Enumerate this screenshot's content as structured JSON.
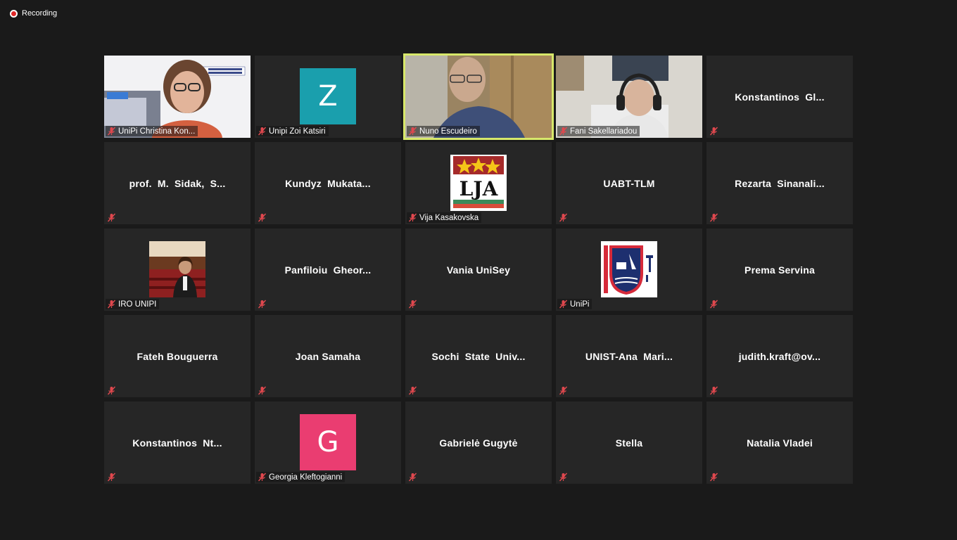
{
  "recording": {
    "label": "Recording"
  },
  "colors": {
    "background": "#1a1a1a",
    "tile": "#262626",
    "active_speaker": "#d7e86a",
    "mute": "#e0484e",
    "teal_avatar": "#1a9fad",
    "pink_avatar": "#ea3d71"
  },
  "tiles": [
    {
      "display": "video",
      "label": "UniPi Christina Kon..."
    },
    {
      "display": "letter",
      "letter": "Z",
      "label": "Unipi Zoi Katsiri"
    },
    {
      "display": "video",
      "label": "Nuno Escudeiro",
      "active": true
    },
    {
      "display": "video",
      "label": "Fani Sakellariadou"
    },
    {
      "display": "name",
      "name": "Konstantinos  Gl..."
    },
    {
      "display": "name",
      "name": "prof.  M.  Sidak,  S..."
    },
    {
      "display": "name",
      "name": "Kundyz  Mukata..."
    },
    {
      "display": "logo",
      "logo_text": "LJA",
      "label": "Vija Kasakovska"
    },
    {
      "display": "name",
      "name": "UABT-TLM"
    },
    {
      "display": "name",
      "name": "Rezarta  Sinanali..."
    },
    {
      "display": "photo",
      "label": "IRO UNIPI"
    },
    {
      "display": "name",
      "name": "Panfiloiu  Gheor..."
    },
    {
      "display": "name",
      "name": "Vania UniSey"
    },
    {
      "display": "logo",
      "logo_text": "",
      "label": "UniPi"
    },
    {
      "display": "name",
      "name": "Prema Servina"
    },
    {
      "display": "name",
      "name": "Fateh Bouguerra"
    },
    {
      "display": "name",
      "name": "Joan Samaha"
    },
    {
      "display": "name",
      "name": "Sochi  State  Univ..."
    },
    {
      "display": "name",
      "name": "UNIST-Ana  Mari..."
    },
    {
      "display": "name",
      "name": "judith.kraft@ov..."
    },
    {
      "display": "name",
      "name": "Konstantinos  Nt..."
    },
    {
      "display": "letter",
      "letter": "G",
      "label": "Georgia Kleftogianni"
    },
    {
      "display": "name",
      "name": "Gabrielė Gugytė"
    },
    {
      "display": "name",
      "name": "Stella"
    },
    {
      "display": "name",
      "name": "Natalia Vladei"
    }
  ]
}
